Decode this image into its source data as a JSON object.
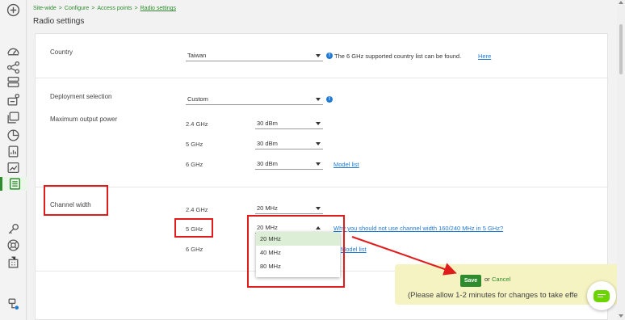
{
  "breadcrumb": {
    "items": [
      "Site-wide",
      "Configure",
      "Access points",
      "Radio settings"
    ],
    "separator": ">"
  },
  "page_title": "Radio settings",
  "country": {
    "label": "Country",
    "value": "Taiwan",
    "note": "The 6 GHz supported country list can be found.",
    "link": "Here"
  },
  "deployment": {
    "label": "Deployment selection",
    "value": "Custom"
  },
  "max_output_power": {
    "label": "Maximum output power",
    "rows": [
      {
        "band": "2.4 GHz",
        "value": "30 dBm"
      },
      {
        "band": "5 GHz",
        "value": "30 dBm"
      },
      {
        "band": "6 GHz",
        "value": "30 dBm"
      }
    ],
    "link": "Model list"
  },
  "channel_width": {
    "label": "Channel width",
    "rows": [
      {
        "band": "2.4 GHz",
        "value": "20 MHz"
      },
      {
        "band": "5 GHz",
        "value": "20 MHz"
      },
      {
        "band": "6 GHz",
        "value": ""
      }
    ],
    "why_link": "Why you should not use channel width 160/240 MHz in 5 GHz?",
    "model_link": "Model list",
    "dropdown_options": [
      "20 MHz",
      "40 MHz",
      "80 MHz"
    ],
    "dropdown_selected": "20 MHz"
  },
  "save_panel": {
    "save_label": "Save",
    "or_text": "or",
    "cancel_label": "Cancel",
    "note": "(Please allow 1-2 minutes for changes to take effe"
  },
  "info_glyph": "!",
  "colors": {
    "accent": "#2e8b2e",
    "link": "#1f7ad6",
    "highlight": "#e01b1b",
    "save_panel_bg": "#f5f3c1",
    "chat": "#6cd400"
  },
  "icons": [
    "add-icon",
    "dashboard-icon",
    "topology-icon",
    "devices-icon",
    "access-point-config-icon",
    "monitor-icon",
    "pie-chart-icon",
    "report-icon",
    "trend-icon",
    "radio-settings-icon",
    "key-icon",
    "help-icon",
    "building-icon",
    "org-icon",
    "chat-icon"
  ]
}
